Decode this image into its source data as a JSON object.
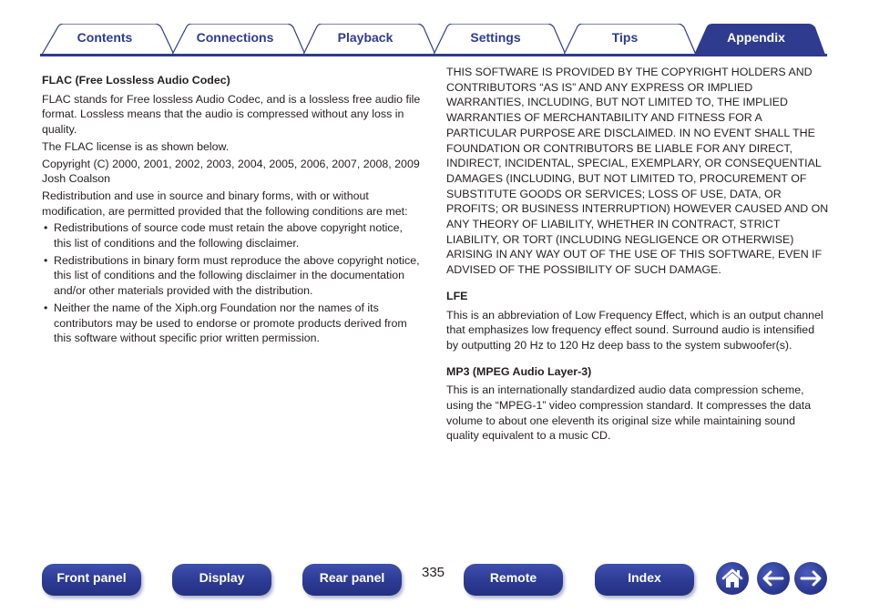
{
  "tabs": [
    {
      "label": "Contents",
      "active": false
    },
    {
      "label": "Connections",
      "active": false
    },
    {
      "label": "Playback",
      "active": false
    },
    {
      "label": "Settings",
      "active": false
    },
    {
      "label": "Tips",
      "active": false
    },
    {
      "label": "Appendix",
      "active": true
    }
  ],
  "colors": {
    "brand": "#2e3b8e",
    "text": "#231f20"
  },
  "left": {
    "flac_heading": "FLAC (Free Lossless Audio Codec)",
    "flac_p1": "FLAC stands for Free lossless Audio Codec, and is a lossless free audio file format. Lossless means that the audio is compressed without any loss in quality.",
    "flac_p2": "The FLAC license is as shown below.",
    "flac_p3": "Copyright (C) 2000, 2001, 2002, 2003, 2004, 2005, 2006, 2007, 2008, 2009 Josh Coalson",
    "flac_p4": "Redistribution and use in source and binary forms, with or without modification, are permitted provided that the following conditions are met:",
    "bullet_char": "•",
    "bullets": [
      "Redistributions of source code must retain the above copyright notice, this list of conditions and the following disclaimer.",
      "Redistributions in binary form must reproduce the above copyright notice, this list of conditions and the following disclaimer in the documentation and/or other materials provided with the distribution.",
      "Neither the name of the Xiph.org Foundation nor the names of its contributors may be used to endorse or promote products derived from this software without specific prior written permission."
    ]
  },
  "right": {
    "disclaimer": "THIS SOFTWARE IS PROVIDED BY THE COPYRIGHT HOLDERS AND CONTRIBUTORS “AS IS” AND ANY EXPRESS OR IMPLIED WARRANTIES, INCLUDING, BUT NOT LIMITED TO, THE IMPLIED WARRANTIES OF MERCHANTABILITY AND FITNESS FOR A PARTICULAR PURPOSE ARE DISCLAIMED. IN NO EVENT SHALL THE FOUNDATION OR CONTRIBUTORS BE LIABLE FOR ANY DIRECT, INDIRECT, INCIDENTAL, SPECIAL, EXEMPLARY, OR CONSEQUENTIAL DAMAGES (INCLUDING, BUT NOT LIMITED TO, PROCUREMENT OF SUBSTITUTE GOODS OR SERVICES; LOSS OF USE, DATA, OR PROFITS; OR BUSINESS INTERRUPTION) HOWEVER CAUSED AND ON ANY THEORY OF LIABILITY, WHETHER IN CONTRACT, STRICT LIABILITY, OR TORT (INCLUDING NEGLIGENCE OR OTHERWISE) ARISING IN ANY WAY OUT OF THE USE OF THIS SOFTWARE, EVEN IF ADVISED OF THE POSSIBILITY OF SUCH DAMAGE.",
    "lfe_heading": "LFE",
    "lfe_body": "This is an abbreviation of Low Frequency Effect, which is an output channel that emphasizes low frequency effect sound. Surround audio is intensified by outputting 20 Hz to 120 Hz deep bass to the system subwoofer(s).",
    "mp3_heading": "MP3 (MPEG Audio Layer-3)",
    "mp3_body": "This is an internationally standardized audio data compression scheme, using the “MPEG-1” video compression standard. It compresses the data volume to about one eleventh its original size while maintaining sound quality equivalent to a music CD."
  },
  "footer": {
    "buttons": [
      "Front panel",
      "Display",
      "Rear panel",
      "Remote",
      "Index"
    ],
    "page_number": "335",
    "icons": [
      "home-icon",
      "back-arrow-icon",
      "forward-arrow-icon"
    ]
  }
}
